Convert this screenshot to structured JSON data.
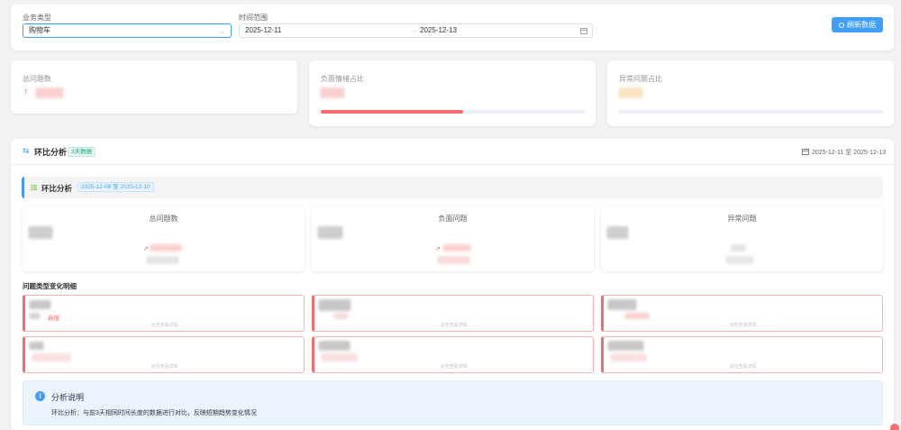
{
  "filter": {
    "business_type_label": "业务类型",
    "business_type_value": "购物车",
    "time_range_label": "时间范围",
    "date_start": "2025-12-11",
    "date_separator": "→",
    "date_end": "2025-12-13",
    "refresh_button": "刷新数据"
  },
  "stats": {
    "total_label": "总问题数",
    "negative_label": "负面情绪占比",
    "negative_ratio": 0.54,
    "abnormal_label": "异常问题占比",
    "abnormal_ratio": 0.0
  },
  "analysis": {
    "title": "环比分析",
    "days_badge": "3天数据",
    "range_text": "2025-12-11 至 2025-12-13",
    "sub_title": "环比分析",
    "compare_range": "2025-12-08 至 2025-12-10",
    "metrics": [
      {
        "title": "总问题数"
      },
      {
        "title": "负面问题"
      },
      {
        "title": "异常问题"
      }
    ],
    "detail_title": "问题类型变化明细",
    "new_label": "新增",
    "detail_hint": "点击查看详情",
    "info_title": "分析说明",
    "info_text": "环比分析：与前3天相同时间长度的数据进行对比，反映短期趋势变化情况"
  },
  "colors": {
    "primary": "#409eff",
    "danger": "#f56c6c",
    "warning": "#e6a23c"
  }
}
